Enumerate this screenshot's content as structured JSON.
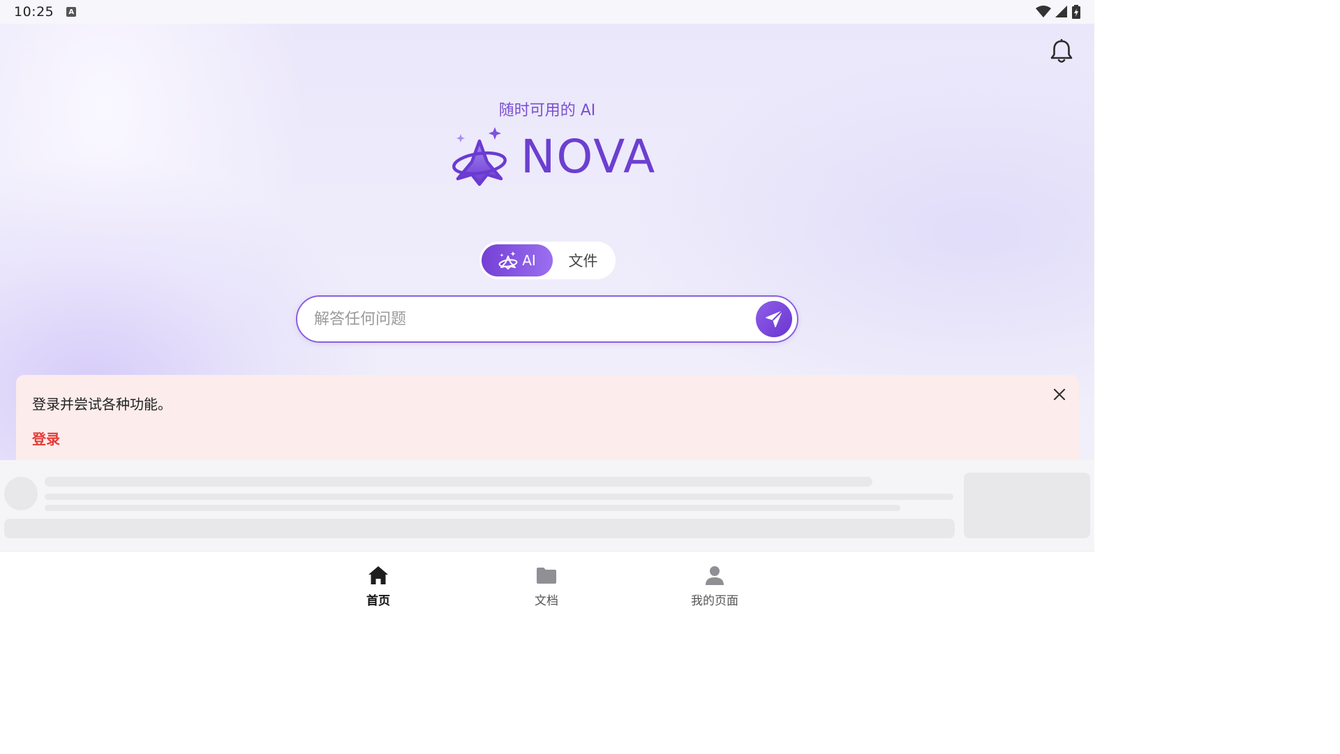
{
  "status_bar": {
    "time": "10:25",
    "indicator": "A"
  },
  "header": {
    "tagline": "随时可用的 AI",
    "logo_text": "NOVA"
  },
  "mode_toggle": {
    "ai_label": "AI",
    "doc_label": "文件",
    "active": "AI"
  },
  "search": {
    "placeholder": "解答任何问题"
  },
  "login_banner": {
    "message": "登录并尝试各种功能。",
    "action": "登录"
  },
  "bottom_nav": [
    {
      "label": "首页",
      "icon": "home-icon",
      "active": true
    },
    {
      "label": "文档",
      "icon": "folder-icon",
      "active": false
    },
    {
      "label": "我的页面",
      "icon": "person-icon",
      "active": false
    }
  ],
  "colors": {
    "accent": "#6c3fd0",
    "banner_bg": "#fdecec",
    "link_red": "#e53935"
  }
}
